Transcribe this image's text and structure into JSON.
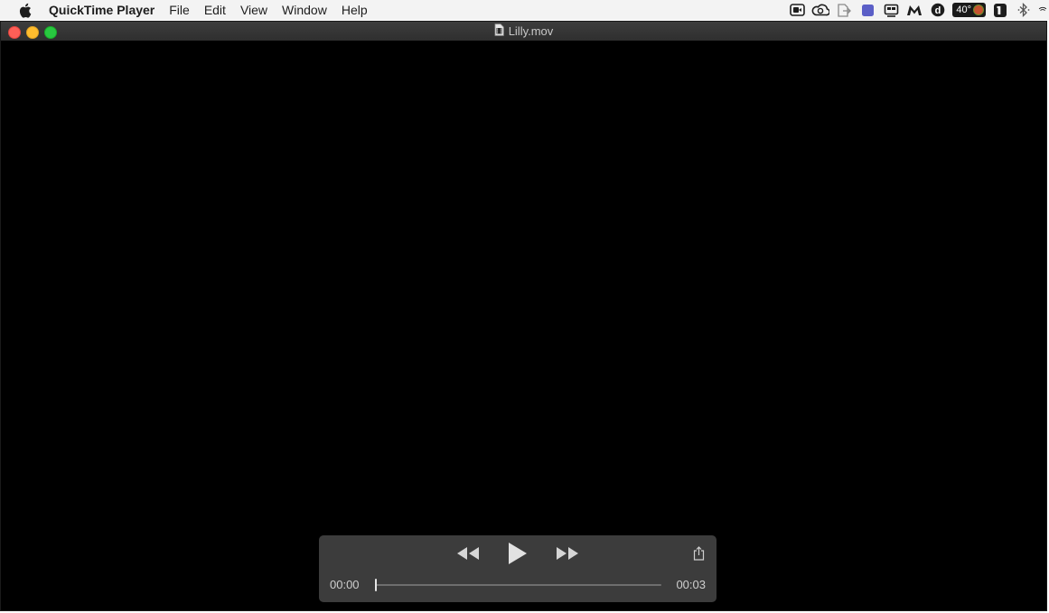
{
  "menubar": {
    "app_name": "QuickTime Player",
    "menus": [
      "File",
      "Edit",
      "View",
      "Window",
      "Help"
    ],
    "status": {
      "temperature": "40°"
    }
  },
  "window": {
    "title": "Lilly.mov"
  },
  "player": {
    "current_time": "00:00",
    "duration": "00:03",
    "progress": 0
  },
  "colors": {
    "close": "#fe5f57",
    "minimize": "#febc2e",
    "zoom": "#28c840",
    "hud_background": "#3e3e3e"
  }
}
